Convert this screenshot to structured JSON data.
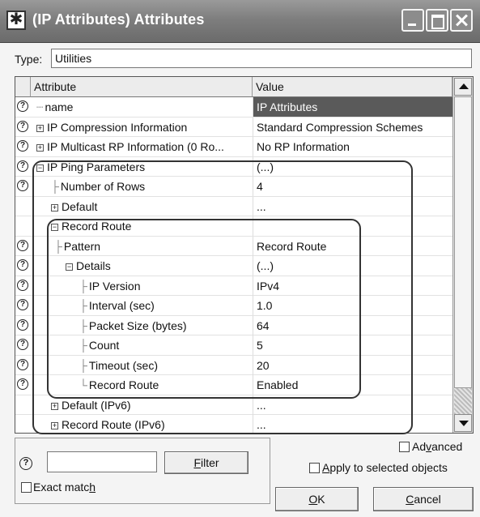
{
  "window": {
    "title": "(IP Attributes) Attributes"
  },
  "type_field": {
    "label": "Type:",
    "value": "Utilities"
  },
  "grid": {
    "col_attribute": "Attribute",
    "col_value": "Value",
    "rows": [
      {
        "q": true,
        "tree": "┈",
        "exp": "",
        "name": "name",
        "value": "IP Attributes",
        "selected": true
      },
      {
        "q": true,
        "tree": "",
        "exp": "+",
        "name": "IP Compression Information",
        "value": "Standard Compression Schemes"
      },
      {
        "q": true,
        "tree": "",
        "exp": "+",
        "name": "IP Multicast RP Information (0 Ro...",
        "value": "No RP Information"
      },
      {
        "q": true,
        "tree": "",
        "exp": "−",
        "name": "IP Ping Parameters",
        "value": "(...)"
      },
      {
        "q": true,
        "tree": "├",
        "exp": "",
        "name": "Number of Rows",
        "value": "4"
      },
      {
        "q": false,
        "tree": "",
        "exp": "+",
        "name": "Default",
        "value": "..."
      },
      {
        "q": false,
        "tree": "",
        "exp": "−",
        "name": "Record Route",
        "value": ""
      },
      {
        "q": true,
        "tree": "├",
        "exp": "",
        "name": "Pattern",
        "value": "Record Route"
      },
      {
        "q": true,
        "tree": "",
        "exp": "−",
        "name": "Details",
        "value": "(...)"
      },
      {
        "q": true,
        "tree": "├",
        "exp": "",
        "name": "IP Version",
        "value": "IPv4"
      },
      {
        "q": true,
        "tree": "├",
        "exp": "",
        "name": "Interval (sec)",
        "value": "1.0"
      },
      {
        "q": true,
        "tree": "├",
        "exp": "",
        "name": "Packet Size (bytes)",
        "value": "64"
      },
      {
        "q": true,
        "tree": "├",
        "exp": "",
        "name": "Count",
        "value": "5"
      },
      {
        "q": true,
        "tree": "├",
        "exp": "",
        "name": "Timeout (sec)",
        "value": "20"
      },
      {
        "q": true,
        "tree": "└",
        "exp": "",
        "name": "Record Route",
        "value": "Enabled"
      },
      {
        "q": false,
        "tree": "",
        "exp": "+",
        "name": "Default (IPv6)",
        "value": "..."
      },
      {
        "q": false,
        "tree": "",
        "exp": "+",
        "name": "Record Route (IPv6)",
        "value": "..."
      }
    ]
  },
  "bottom": {
    "help_glyph": "?",
    "filter_value": "",
    "filter_button_prefix": "",
    "filter_button_u": "F",
    "filter_button_rest": "ilter",
    "exact_match_prefix": "Exact matc",
    "exact_match_u": "h",
    "exact_match_rest": "",
    "advanced_prefix": "Ad",
    "advanced_u": "v",
    "advanced_rest": "anced",
    "apply_prefix": "",
    "apply_u": "A",
    "apply_rest": "pply to selected objects",
    "ok_u": "O",
    "ok_rest": "K",
    "cancel_u": "C",
    "cancel_rest": "ancel"
  },
  "icons": {
    "question": "question-icon",
    "expand": "expand-icon",
    "collapse": "collapse-icon"
  }
}
